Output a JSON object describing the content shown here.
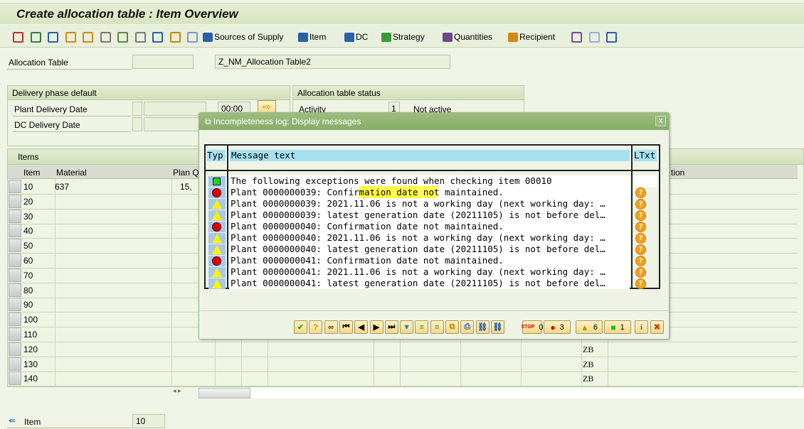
{
  "title": "Create allocation table : Item Overview",
  "toolbar": {
    "icons": [
      "hat-icon",
      "search-icon",
      "factory-icon",
      "warehouse-icon",
      "network-icon",
      "copy-icon",
      "next-doc-icon",
      "doc-icon",
      "trash-icon",
      "lock-icon",
      "refresh-icon"
    ],
    "buttons": [
      {
        "label": "Sources of Supply",
        "icon": "binoculars-icon"
      },
      {
        "label": "Item",
        "icon": "item-icon"
      },
      {
        "label": "DC",
        "icon": "dc-icon"
      },
      {
        "label": "Strategy",
        "icon": "strategy-icon"
      },
      {
        "label": "Quantities",
        "icon": "quantities-icon"
      },
      {
        "label": "Recipient",
        "icon": "truck-icon"
      }
    ],
    "right_icons": [
      "grid-icon",
      "binoculars-icon",
      "gear-icon"
    ]
  },
  "header": {
    "alloc_label": "Allocation Table",
    "alloc_value": "",
    "alloc_desc": "Z_NM_Allocation Table2"
  },
  "delivery": {
    "title": "Delivery phase default",
    "plant_label": "Plant Delivery Date",
    "plant_time": "00:00",
    "dc_label": "DC Delivery Date"
  },
  "status": {
    "title": "Allocation table status",
    "activity_label": "Activity",
    "activity_value": "1",
    "activity_text": "Not active"
  },
  "items": {
    "title": "Items",
    "columns": [
      "Item",
      "Material",
      "Plan Q",
      "tion"
    ],
    "rows": [
      {
        "item": "10",
        "material": "637",
        "planq": "15,",
        "zb": ""
      },
      {
        "item": "20"
      },
      {
        "item": "30"
      },
      {
        "item": "40"
      },
      {
        "item": "50"
      },
      {
        "item": "60"
      },
      {
        "item": "70"
      },
      {
        "item": "80"
      },
      {
        "item": "90"
      },
      {
        "item": "100"
      },
      {
        "item": "110"
      },
      {
        "item": "120",
        "zb": "ZB"
      },
      {
        "item": "130",
        "zb": "ZB"
      },
      {
        "item": "140",
        "zb": "ZB"
      }
    ]
  },
  "footer": {
    "item_label": "Item",
    "item_value": "10"
  },
  "dialog": {
    "title": "Incompleteness log: Display messages",
    "col_typ": "Typ",
    "col_msg": "Message text",
    "col_ltxt": "LTxt",
    "messages": [
      {
        "type": "success",
        "text": "The following exceptions were found when checking item 00010",
        "ltxt": false
      },
      {
        "type": "error",
        "text": "Plant 0000000039: Confirmation date  not maintained.",
        "ltxt": true
      },
      {
        "type": "warning",
        "text": "Plant 0000000039: 2021.11.06 is not a working day (next working day: …",
        "ltxt": true
      },
      {
        "type": "warning",
        "text": "Plant 0000000039: latest generation date (20211105) is not before del…",
        "ltxt": true
      },
      {
        "type": "error",
        "text": "Plant 0000000040: Confirmation date  not maintained.",
        "ltxt": true
      },
      {
        "type": "warning",
        "text": "Plant 0000000040: 2021.11.06 is not a working day (next working day: …",
        "ltxt": true
      },
      {
        "type": "warning",
        "text": "Plant 0000000040: latest generation date (20211105) is not before del…",
        "ltxt": true
      },
      {
        "type": "error",
        "text": "Plant 0000000041: Confirmation date  not maintained.",
        "ltxt": true
      },
      {
        "type": "warning",
        "text": "Plant 0000000041: 2021.11.06 is not a working day (next working day: …",
        "ltxt": true
      },
      {
        "type": "warning",
        "text": "Plant 0000000041: latest generation date (20211105) is not before del…",
        "ltxt": true
      }
    ],
    "counts": {
      "stop": "0",
      "error": "3",
      "warning": "6",
      "success": "1"
    }
  }
}
